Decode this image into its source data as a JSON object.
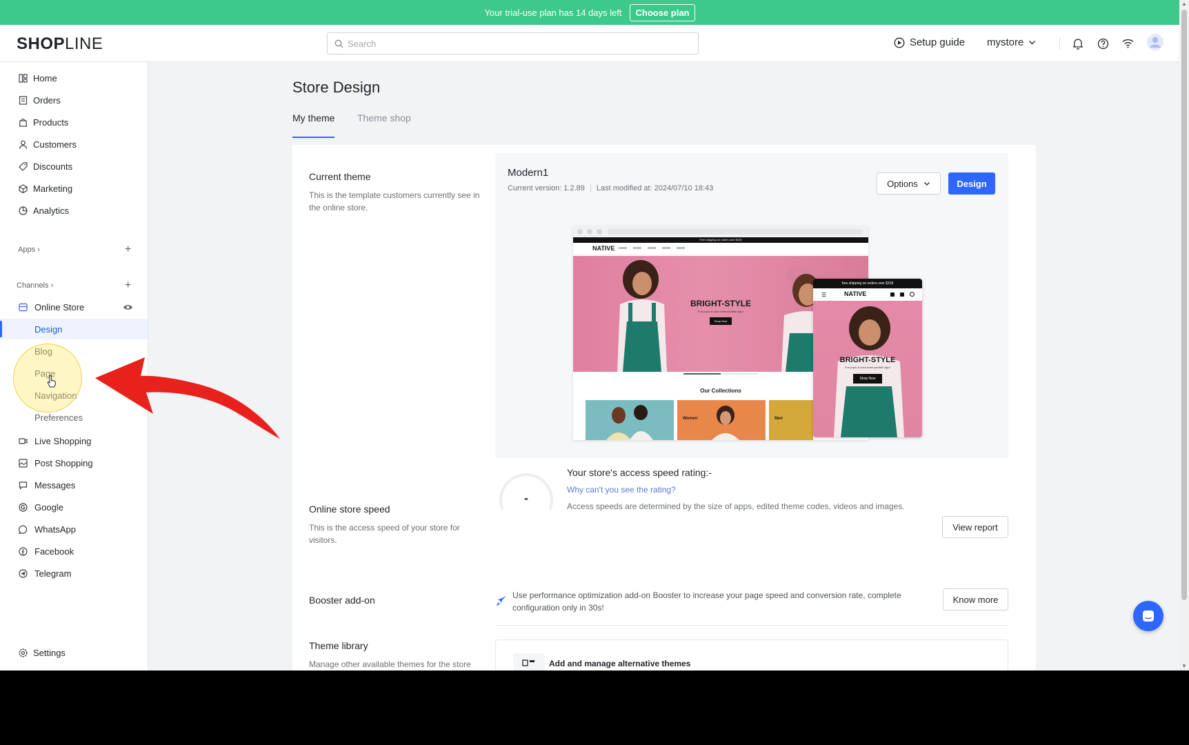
{
  "trial_bar": {
    "message": "Your trial-use plan has 14 days left",
    "cta": "Choose plan"
  },
  "topbar": {
    "logo_bold": "SHOP",
    "logo_light": "LINE",
    "search_placeholder": "Search",
    "setup_guide": "Setup guide",
    "store_name": "mystore"
  },
  "sidebar": {
    "items": [
      {
        "label": "Home",
        "icon": "home-icon"
      },
      {
        "label": "Orders",
        "icon": "orders-icon"
      },
      {
        "label": "Products",
        "icon": "products-icon"
      },
      {
        "label": "Customers",
        "icon": "customers-icon"
      },
      {
        "label": "Discounts",
        "icon": "discounts-icon"
      },
      {
        "label": "Marketing",
        "icon": "marketing-icon"
      },
      {
        "label": "Analytics",
        "icon": "analytics-icon"
      }
    ],
    "apps_label": "Apps",
    "channels_label": "Channels",
    "online_store": "Online Store",
    "online_store_sub": [
      "Design",
      "Blog",
      "Page",
      "Navigation",
      "Preferences"
    ],
    "channels": [
      {
        "label": "Live Shopping",
        "icon": "live-icon"
      },
      {
        "label": "Post Shopping",
        "icon": "post-icon"
      },
      {
        "label": "Messages",
        "icon": "messages-icon"
      },
      {
        "label": "Google",
        "icon": "google-icon"
      },
      {
        "label": "WhatsApp",
        "icon": "whatsapp-icon"
      },
      {
        "label": "Facebook",
        "icon": "facebook-icon"
      },
      {
        "label": "Telegram",
        "icon": "telegram-icon"
      }
    ],
    "settings": "Settings"
  },
  "main": {
    "title": "Store Design",
    "tabs": [
      {
        "label": "My theme"
      },
      {
        "label": "Theme shop"
      }
    ],
    "current_theme": {
      "title": "Current theme",
      "desc": "This is the template customers currently see in the online store.",
      "name": "Modern1",
      "version": "Current version: 1.2.89",
      "modified": "Last modified at:  2024/07/10 18:43",
      "options_label": "Options",
      "design_label": "Design"
    },
    "preview": {
      "promo_text": "Free shipping on orders over $159",
      "brand": "NATIVE",
      "hero_title": "BRIGHT-STYLE",
      "hero_sub": "Fun pops of color meet youthful vigor",
      "hero_button": "Shop Now",
      "collections_title": "Our Collections",
      "collection_labels": [
        "Women",
        "Men"
      ],
      "mobile_promo": "free shipping on orders over $159"
    },
    "speed": {
      "title": "Online store speed",
      "desc": "This is the access speed of your store for visitors.",
      "gauge_value": "-",
      "rating_title": "Your store's access speed rating:-",
      "link": "Why can't you see the rating?",
      "note": "Access speeds are determined by the size of apps, edited theme codes, videos and images.",
      "button": "View report"
    },
    "booster": {
      "title": "Booster add-on",
      "text": "Use performance optimization add-on Booster to increase your page speed and conversion rate, complete configuration only in 30s!",
      "button": "Know more"
    },
    "library": {
      "title": "Theme library",
      "desc": "Manage other available themes for the store",
      "box_title": "Add and manage alternative themes"
    }
  },
  "colors": {
    "primary": "#2e67ff",
    "trial_bar": "#3cc98a",
    "annotation_arrow": "#e8211c",
    "highlight": "#ffe65a"
  }
}
